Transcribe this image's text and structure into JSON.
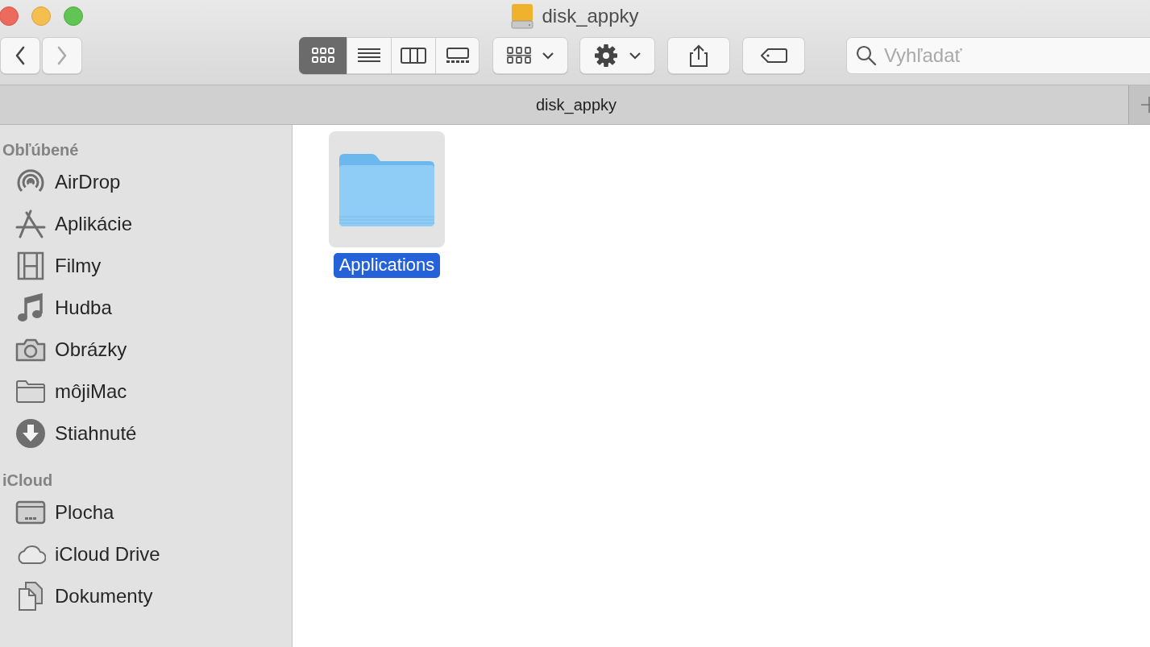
{
  "window": {
    "title": "disk_appky"
  },
  "toolbar": {
    "navigation": [
      {
        "kind": "back",
        "disabled": false
      },
      {
        "kind": "forward",
        "disabled": true
      }
    ],
    "view_modes": [
      {
        "kind": "icons",
        "selected": true
      },
      {
        "kind": "list",
        "selected": false
      },
      {
        "kind": "columns",
        "selected": false
      },
      {
        "kind": "gallery",
        "selected": false
      }
    ],
    "search": {
      "placeholder": "Vyhľadať"
    }
  },
  "tab_bar": {
    "title": "disk_appky"
  },
  "sidebar": {
    "sections": [
      {
        "title": "Obľúbené",
        "items": [
          {
            "label": "AirDrop",
            "kind": "airdrop"
          },
          {
            "label": "Aplikácie",
            "kind": "apps"
          },
          {
            "label": "Filmy",
            "kind": "film"
          },
          {
            "label": "Hudba",
            "kind": "music"
          },
          {
            "label": "Obrázky",
            "kind": "camera"
          },
          {
            "label": "môjiMac",
            "kind": "folder"
          },
          {
            "label": "Stiahnuté",
            "kind": "download"
          }
        ]
      },
      {
        "title": "iCloud",
        "items": [
          {
            "label": "Plocha",
            "kind": "desktop"
          },
          {
            "label": "iCloud Drive",
            "kind": "cloud"
          },
          {
            "label": "Dokumenty",
            "kind": "documents"
          }
        ]
      }
    ]
  },
  "files": [
    {
      "name": "Applications",
      "selected": true
    }
  ]
}
